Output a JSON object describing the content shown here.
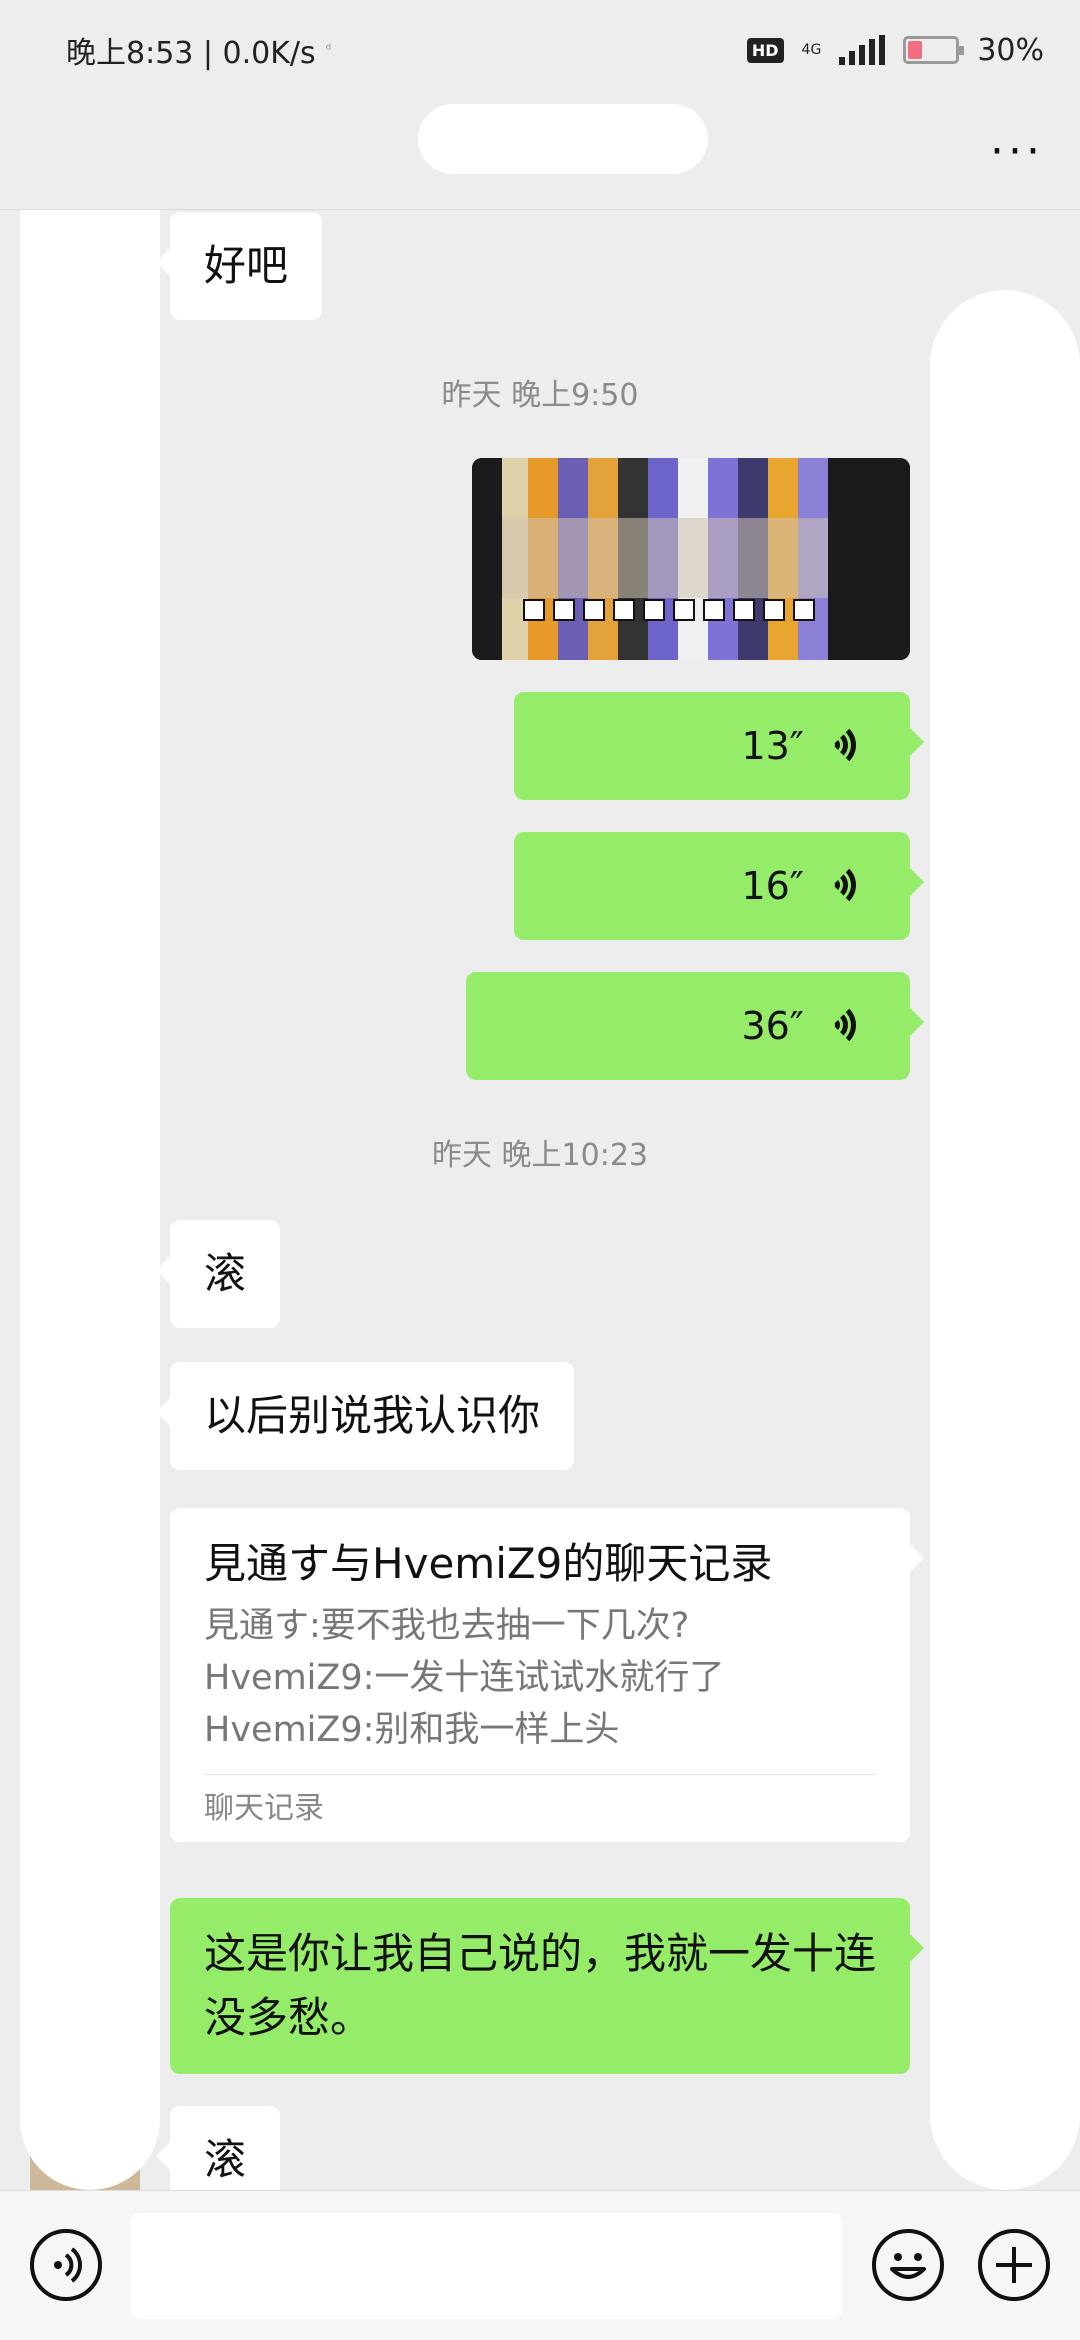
{
  "status_bar": {
    "time": "晚上8:53 | 0.0K/s",
    "indicator": "ᵈ",
    "hd": "HD",
    "network": "4G",
    "battery_text": "30%",
    "battery_level": 0.3
  },
  "header": {
    "more_icon": "more-icon",
    "more_label": "···"
  },
  "messages": {
    "m1": {
      "text": "好吧",
      "direction": "incoming"
    },
    "t1": "昨天 晚上9:50",
    "img1": {
      "type": "image",
      "direction": "outgoing"
    },
    "v1": {
      "duration": "13″",
      "direction": "outgoing"
    },
    "v2": {
      "duration": "16″",
      "direction": "outgoing"
    },
    "v3": {
      "duration": "36″",
      "direction": "outgoing"
    },
    "t2": "昨天 晚上10:23",
    "m2": {
      "text": "滚",
      "direction": "incoming"
    },
    "m3": {
      "text": "以后别说我认识你",
      "direction": "incoming"
    },
    "record": {
      "title": "見通す与HvemiZ9的聊天记录",
      "lines": [
        "見通す:要不我也去抽一下几次?",
        "HvemiZ9:一发十连试试水就行了",
        "HvemiZ9:别和我一样上头"
      ],
      "footer": "聊天记录"
    },
    "m4": {
      "text": "这是你让我自己说的，我就一发十连没多愁。",
      "direction": "outgoing"
    },
    "m5": {
      "text": "滚",
      "direction": "incoming"
    }
  },
  "input_bar": {
    "voice_icon": "voice-input-icon",
    "emoji_icon": "emoji-icon",
    "plus_icon": "plus-icon"
  },
  "colors": {
    "background": "#ededed",
    "outgoing_bubble": "#95ec69",
    "incoming_bubble": "#ffffff",
    "timestamp": "#8a8a8a"
  }
}
